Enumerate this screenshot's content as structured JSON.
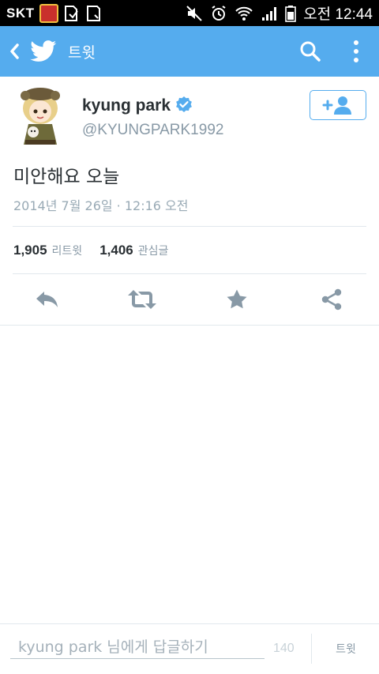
{
  "status_bar": {
    "carrier": "SKT",
    "time": "오전 12:44"
  },
  "app_bar": {
    "title": "트윗",
    "color": "#55acee"
  },
  "tweet": {
    "author_name": "kyung park",
    "handle": "@KYUNGPARK1992",
    "verified": true,
    "text": "미안해요 오늘",
    "timestamp": "2014년 7월 26일 · 12:16 오전",
    "retweets": {
      "count": "1,905",
      "label": "리트윗"
    },
    "favorites": {
      "count": "1,406",
      "label": "관심글"
    }
  },
  "reply_bar": {
    "placeholder": "kyung park 님에게 답글하기",
    "char_count": "140",
    "tweet_button": "트윗"
  },
  "colors": {
    "accent": "#55acee",
    "action_icon": "#8899a6"
  }
}
